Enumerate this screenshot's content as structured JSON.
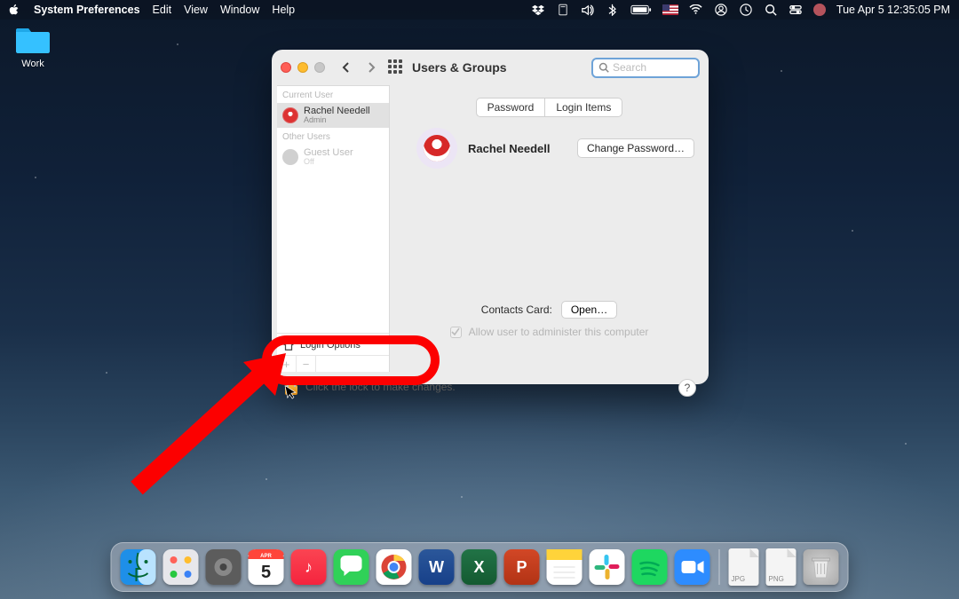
{
  "menubar": {
    "app_name": "System Preferences",
    "items": [
      "Edit",
      "View",
      "Window",
      "Help"
    ],
    "datetime": "Tue Apr 5  12:35:05 PM",
    "status_icons": [
      "dropbox",
      "storage",
      "volume",
      "bluetooth",
      "battery",
      "flag-us",
      "wifi",
      "user",
      "clock",
      "spotlight",
      "control-center",
      "avatar"
    ]
  },
  "desktop_folder": {
    "label": "Work"
  },
  "window": {
    "title": "Users & Groups",
    "search_placeholder": "Search",
    "tabs": {
      "password": "Password",
      "login_items": "Login Items"
    },
    "sidebar": {
      "current_label": "Current User",
      "current": {
        "name": "Rachel Needell",
        "role": "Admin"
      },
      "other_label": "Other Users",
      "guest": {
        "name": "Guest User",
        "status": "Off"
      },
      "login_options": "Login Options"
    },
    "profile": {
      "name": "Rachel Needell",
      "change_password": "Change Password…"
    },
    "contacts": {
      "label": "Contacts Card:",
      "open": "Open…"
    },
    "admin_check": "Allow user to administer this computer",
    "lock_text": "Click the lock to make changes.",
    "help": "?"
  },
  "dock": {
    "apps": [
      {
        "name": "finder",
        "bg": "linear-gradient(#3aa0f4,#0a6bd1)",
        "glyph": ""
      },
      {
        "name": "launchpad",
        "bg": "#e7e7eb",
        "glyph": ""
      },
      {
        "name": "settings",
        "bg": "linear-gradient(#6a6a6a,#3a3a3a)",
        "glyph": ""
      },
      {
        "name": "calendar",
        "bg": "#fff",
        "glyph": "5"
      },
      {
        "name": "music",
        "bg": "linear-gradient(#fb4452,#f5243e)",
        "glyph": "♪"
      },
      {
        "name": "messages",
        "bg": "linear-gradient(#5de266,#22c33b)",
        "glyph": ""
      },
      {
        "name": "chrome",
        "bg": "#fff",
        "glyph": ""
      },
      {
        "name": "word",
        "bg": "linear-gradient(#2b579a,#174089)",
        "glyph": "W"
      },
      {
        "name": "excel",
        "bg": "linear-gradient(#217346,#145a31)",
        "glyph": "X"
      },
      {
        "name": "powerpoint",
        "bg": "linear-gradient(#d24726,#b23315)",
        "glyph": "P"
      },
      {
        "name": "notes",
        "bg": "linear-gradient(#ffd33a 30%,#fff 30%)",
        "glyph": ""
      },
      {
        "name": "slack",
        "bg": "#fff",
        "glyph": ""
      },
      {
        "name": "spotify",
        "bg": "linear-gradient(#1ed760,#12b74a)",
        "glyph": ""
      },
      {
        "name": "zoom",
        "bg": "linear-gradient(#2d8cff,#0b6bdf)",
        "glyph": ""
      }
    ],
    "docs": [
      "JPG",
      "PNG"
    ],
    "trash": "trash"
  }
}
